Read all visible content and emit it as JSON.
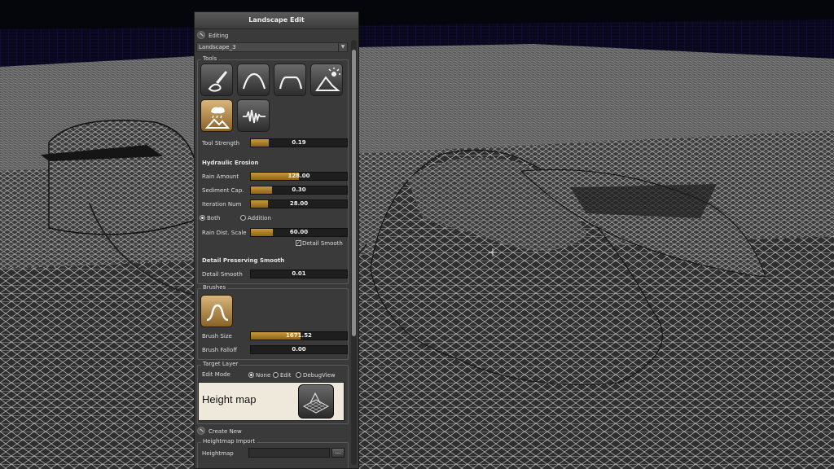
{
  "panel": {
    "title": "Landscape Edit",
    "editing_label": "Editing",
    "landscape_selected": "Landscape_3"
  },
  "tools": {
    "group_label": "Tools",
    "items": [
      {
        "name": "paint-brush-icon",
        "active": false
      },
      {
        "name": "smooth-icon",
        "active": false
      },
      {
        "name": "flatten-icon",
        "active": false
      },
      {
        "name": "erosion-icon",
        "active": false
      },
      {
        "name": "hydraulic-erosion-icon",
        "active": true
      },
      {
        "name": "noise-icon",
        "active": false
      }
    ],
    "tool_strength_label": "Tool Strength",
    "tool_strength_value": "0.19",
    "tool_strength_fill": 0.19
  },
  "hydraulic": {
    "heading": "Hydraulic Erosion",
    "rain_amount_label": "Rain Amount",
    "rain_amount_value": "128.00",
    "rain_amount_fill": 0.5,
    "sediment_label": "Sediment Cap.",
    "sediment_value": "0.30",
    "sediment_fill": 0.22,
    "iteration_label": "Iteration Num",
    "iteration_value": "28.00",
    "iteration_fill": 0.18,
    "opt_both": "Both",
    "opt_addition": "Addition",
    "rain_dist_label": "Rain Dist. Scale",
    "rain_dist_value": "60.00",
    "rain_dist_fill": 0.23,
    "detail_smooth_check_label": "Detail Smooth"
  },
  "detail": {
    "heading": "Detail Preserving Smooth",
    "detail_smooth_label": "Detail Smooth",
    "detail_smooth_value": "0.01",
    "detail_smooth_fill": 0.0
  },
  "brushes": {
    "group_label": "Brushes",
    "brush_size_label": "Brush Size",
    "brush_size_value": "1671.52",
    "brush_size_fill": 0.52,
    "brush_falloff_label": "Brush Falloff",
    "brush_falloff_value": "0.00",
    "brush_falloff_fill": 0.0
  },
  "target_layer": {
    "group_label": "Target Layer",
    "edit_mode_label": "Edit Mode",
    "mode_none": "None",
    "mode_edit": "Edit",
    "mode_debug": "DebugView",
    "layer_name": "Height map"
  },
  "create_new": {
    "label": "Create New",
    "import_group_label": "Heightmap Import",
    "heightmap_label": "Heightmap",
    "browse_label": "..."
  },
  "colors": {
    "accent": "#c89a3a",
    "panel_bg": "#3a3a3a",
    "card_bg": "#efe9db"
  }
}
